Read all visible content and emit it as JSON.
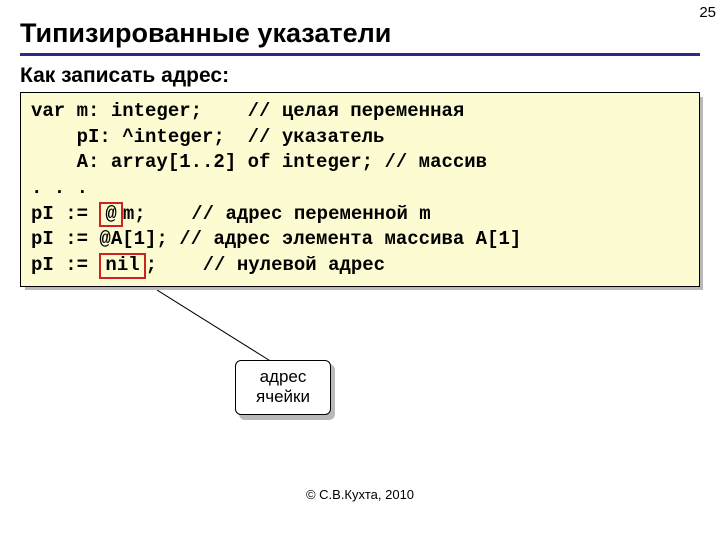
{
  "page_number": "25",
  "title": "Типизированные указатели",
  "subtitle": "Как записать адрес:",
  "code": {
    "l1a": "var m: integer;    // ",
    "l1b": "целая переменная",
    "l2a": "    pI: ^integer;  // ",
    "l2b": "указатель",
    "l3a": "    A: array[1..2] of integer; // ",
    "l3b": "массив",
    "l4": ". . .",
    "l5a": "pI := ",
    "l5_hl": "@",
    "l5b": "m;    // ",
    "l5c": "адрес переменной m",
    "l6a": "pI := @A[1]; // ",
    "l6b": "адрес элемента массива A[1]",
    "l7a": "pI := ",
    "l7_hl": "nil",
    "l7b": ";    // ",
    "l7c": "нулевой адрес"
  },
  "callout": {
    "line1": "адрес",
    "line2": "ячейки"
  },
  "footer": "© С.В.Кухта, 2010"
}
